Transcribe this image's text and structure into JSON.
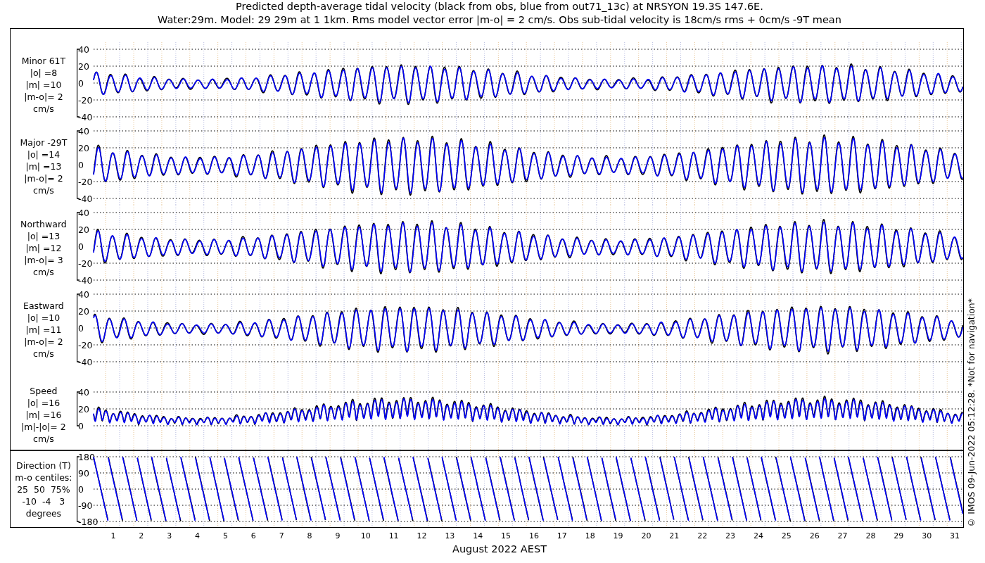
{
  "title": [
    "Predicted depth-average tidal velocity (black from obs, blue from out71_13c) at NRSYON 19.3S 147.6E.",
    "Water:29m. Model: 29 29m at 1 1km. Rms model vector error |m-o| = 2 cm/s. Obs sub-tidal velocity is 18cm/s rms + 0cm/s -9T mean"
  ],
  "panels": [
    {
      "kind": "signed",
      "label": [
        "Minor 61T",
        "|o| =8",
        "|m| =10",
        "|m-o|= 2",
        "cm/s"
      ],
      "yticks": [
        "40",
        "20",
        "0",
        "-20",
        "-40"
      ]
    },
    {
      "kind": "signed",
      "label": [
        "Major -29T",
        "|o| =14",
        "|m| =13",
        "|m-o|= 2",
        "cm/s"
      ],
      "yticks": [
        "40",
        "20",
        "0",
        "-20",
        "-40"
      ]
    },
    {
      "kind": "signed",
      "label": [
        "Northward",
        "|o| =13",
        "|m| =12",
        "|m-o|= 3",
        "cm/s"
      ],
      "yticks": [
        "40",
        "20",
        "0",
        "-20",
        "-40"
      ]
    },
    {
      "kind": "signed",
      "label": [
        "Eastward",
        "|o| =10",
        "|m| =11",
        "|m-o|= 2",
        "cm/s"
      ],
      "yticks": [
        "40",
        "20",
        "0",
        "-20",
        "-40"
      ]
    },
    {
      "kind": "speed",
      "label": [
        "Speed",
        "|o| =16",
        "|m| =16",
        "|m|-|o|= 2",
        "cm/s"
      ],
      "yticks": [
        "40",
        "20",
        "0"
      ]
    },
    {
      "kind": "direction",
      "label": [
        "Direction (T)",
        "m-o centiles:",
        "25  50  75%",
        "-10  -4   3",
        "degrees"
      ],
      "yticks": [
        "180",
        "90",
        "0",
        "-90",
        "-180"
      ]
    }
  ],
  "days": [
    "1",
    "2",
    "3",
    "4",
    "5",
    "6",
    "7",
    "8",
    "9",
    "10",
    "11",
    "12",
    "13",
    "14",
    "15",
    "16",
    "17",
    "18",
    "19",
    "20",
    "21",
    "22",
    "23",
    "24",
    "25",
    "26",
    "27",
    "28",
    "29",
    "30",
    "31"
  ],
  "xlabel": "August 2022 AEST",
  "credit": "© IMOS 09-Jun-2022 05:12:28. *Not for navigation*"
}
